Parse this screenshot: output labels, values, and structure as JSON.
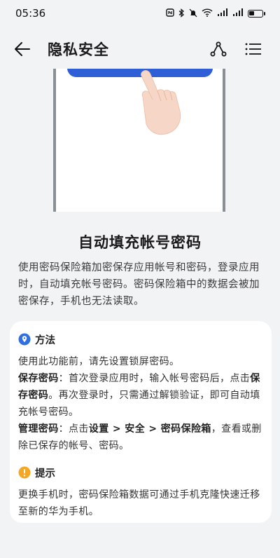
{
  "status": {
    "time": "05:36",
    "icons": [
      "nfc-icon",
      "bluetooth-icon",
      "mute-icon",
      "wifi-icon",
      "signal-icon",
      "signal-icon",
      "battery-icon"
    ]
  },
  "appbar": {
    "title": "隐私安全",
    "back_icon": "back-arrow-icon",
    "share_icon": "route-icon",
    "menu_icon": "list-icon"
  },
  "feature": {
    "title": "自动填充帐号密码",
    "description": "使用密码保险箱加密保存应用帐号和密码，登录应用时，自动填充帐号密码。密码保险箱中的数据会被加密保存，手机也无法读取。"
  },
  "method": {
    "title": "方法",
    "intro": "使用此功能前，请先设置锁屏密码。",
    "save": {
      "label": "保存密码",
      "text1": "：首次登录应用时，输入帐号密码后，点击",
      "label2": "保存密码",
      "text2": "。再次登录时，只需通过解锁验证，即可自动填充帐号密码。"
    },
    "manage": {
      "label": "管理密码",
      "text1": "：点击",
      "path": "设置 > 安全 > 密码保险箱",
      "text2": "，查看或删除已保存的帐号、密码。"
    }
  },
  "tip": {
    "title": "提示",
    "text": "更换手机时，密码保险箱数据可通过手机克隆快速迁移至新的华为手机。"
  },
  "colors": {
    "background": "#f1f3f5",
    "accent_blue": "#2f6fe0",
    "tip_orange": "#f5a623"
  }
}
